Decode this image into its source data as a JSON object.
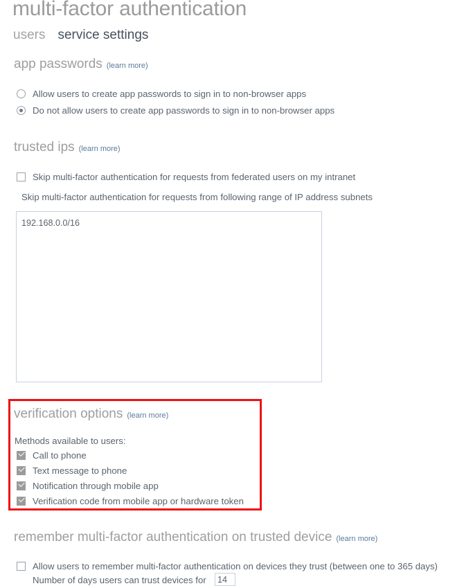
{
  "page": {
    "title": "multi-factor authentication",
    "learn_more_label": "(learn more)"
  },
  "tabs": [
    {
      "label": "users",
      "active": false
    },
    {
      "label": "service settings",
      "active": true
    }
  ],
  "sections": {
    "app_passwords": {
      "heading": "app passwords",
      "learn_more": "(learn more)",
      "options": [
        {
          "label": "Allow users to create app passwords to sign in to non-browser apps",
          "selected": false
        },
        {
          "label": "Do not allow users to create app passwords to sign in to non-browser apps",
          "selected": true
        }
      ]
    },
    "trusted_ips": {
      "heading": "trusted ips",
      "learn_more": "(learn more)",
      "checkbox_label": "Skip multi-factor authentication for requests from federated users on my intranet",
      "checkbox_checked": false,
      "subnets_label": "Skip multi-factor authentication for requests from following range of IP address subnets",
      "subnets_value": "192.168.0.0/16",
      "subnets_placeholder": ""
    },
    "verification_options": {
      "heading": "verification options",
      "learn_more": "(learn more)",
      "methods_label": "Methods available to users:",
      "highlighted": true,
      "highlight_color": "#ee1111",
      "methods": [
        {
          "label": "Call to phone",
          "checked": true
        },
        {
          "label": "Text message to phone",
          "checked": true
        },
        {
          "label": "Notification through mobile app",
          "checked": true
        },
        {
          "label": "Verification code from mobile app or hardware token",
          "checked": true
        }
      ]
    },
    "remember_mfa": {
      "heading": "remember multi-factor authentication on trusted device",
      "learn_more": "(learn more)",
      "checkbox_label": "Allow users to remember multi-factor authentication on devices they trust (between one to 365 days)",
      "checkbox_checked": false,
      "days_label": "Number of days users can trust devices for",
      "days_value": "14"
    }
  },
  "colors": {
    "heading": "#9e9e9e",
    "body_text": "#5a636e",
    "link": "#5b7b9b",
    "accent_highlight": "#ee1111",
    "field_border": "#c9d1dc"
  }
}
